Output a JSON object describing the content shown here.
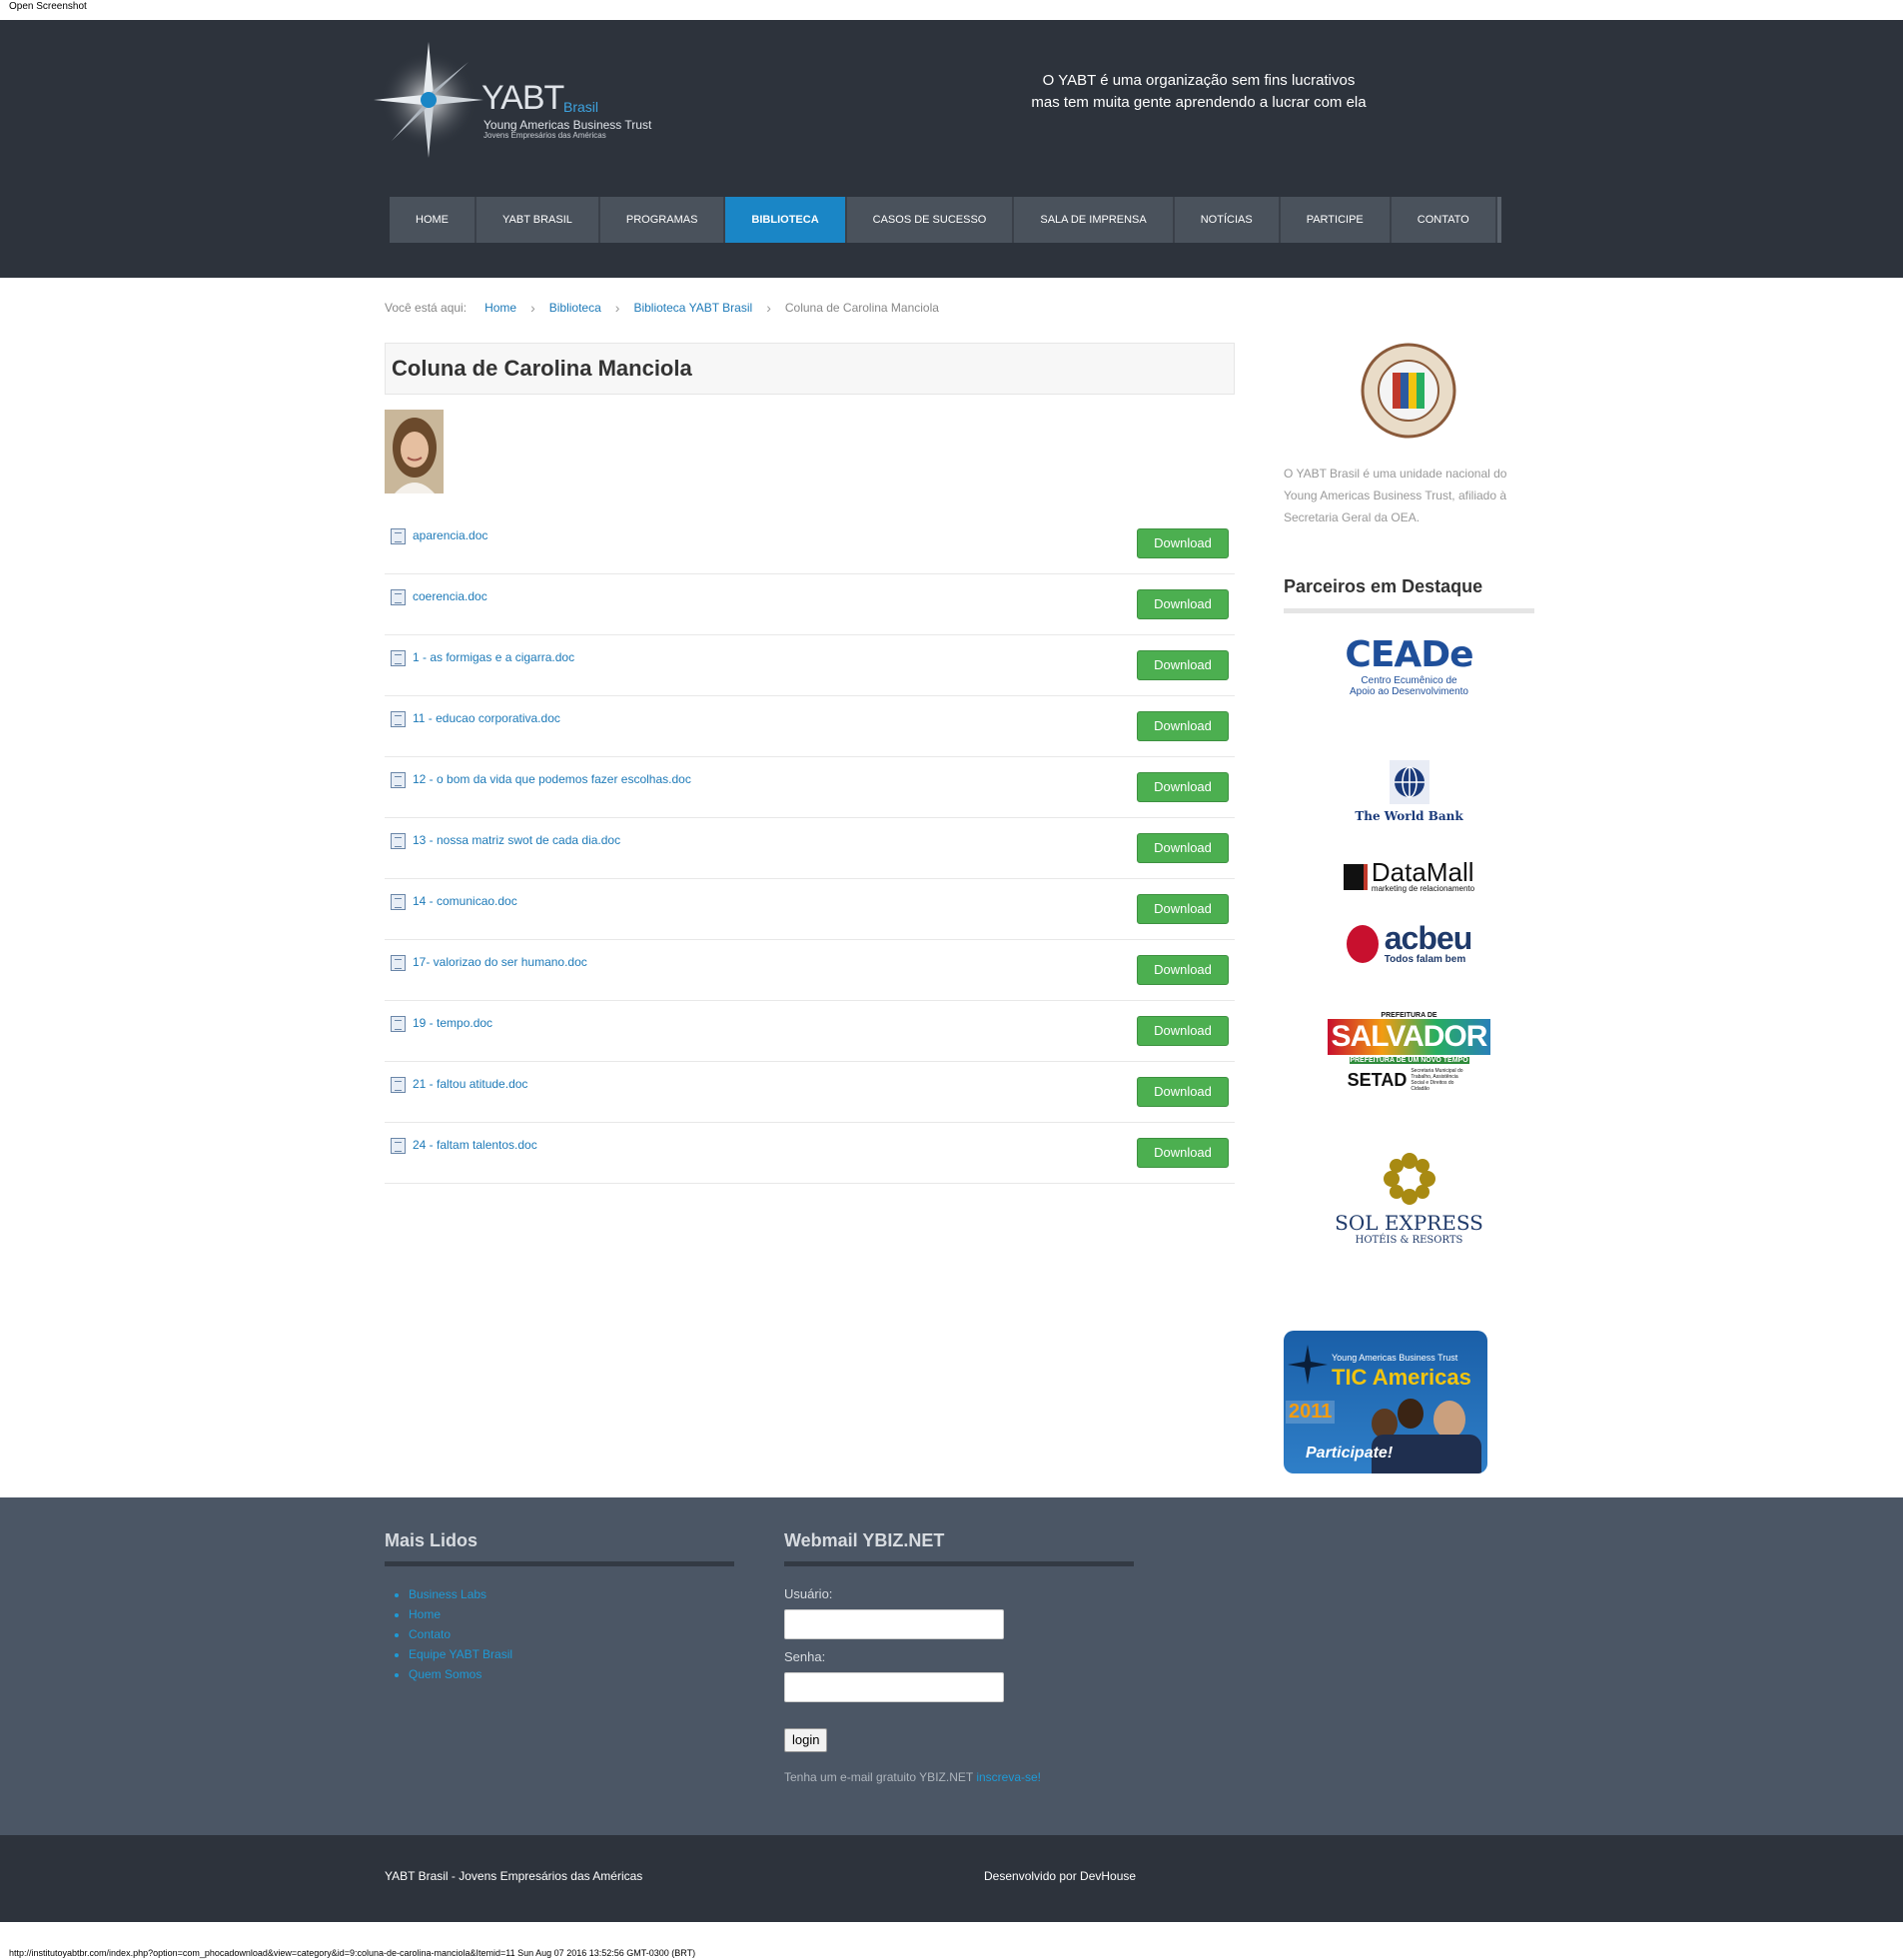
{
  "browser": {
    "top_label": "Open Screenshot",
    "status_url": "http://institutoyabtbr.com/index.php?option=com_phocadownload&view=category&id=9:coluna-de-carolina-manciola&Itemid=11 Sun Aug 07 2016 13:52:56 GMT-0300 (BRT)"
  },
  "header": {
    "logo": {
      "name": "YABT",
      "country": "Brasil",
      "subtitle": "Young Americas Business Trust",
      "subtitle2": "Jovens Empresários das Américas"
    },
    "tagline_line1": "O YABT é uma organização sem fins lucrativos",
    "tagline_line2": "mas tem muita gente aprendendo a lucrar com ela",
    "nav": [
      "HOME",
      "YABT BRASIL",
      "PROGRAMAS",
      "BIBLIOTECA",
      "CASOS DE SUCESSO",
      "SALA DE IMPRENSA",
      "NOTÍCIAS",
      "PARTICIPE",
      "CONTATO"
    ],
    "nav_active": "BIBLIOTECA"
  },
  "breadcrumb": {
    "prefix": "Você está aqui:",
    "items": [
      "Home",
      "Biblioteca",
      "Biblioteca YABT Brasil"
    ],
    "current": "Coluna de Carolina Manciola"
  },
  "page": {
    "title": "Coluna de Carolina Manciola",
    "download_label": "Download",
    "files": [
      "aparencia.doc",
      "coerencia.doc",
      "1 - as formigas e a cigarra.doc",
      "11 - educao corporativa.doc",
      "12 - o bom da vida que podemos fazer escolhas.doc",
      "13 - nossa matriz swot de cada dia.doc",
      "14 - comunicao.doc",
      "17- valorizao do ser humano.doc",
      "19 - tempo.doc",
      "21 - faltou atitude.doc",
      "24 - faltam talentos.doc"
    ]
  },
  "sidebar": {
    "oas_text": "O YABT Brasil é uma unidade nacional do Young Americas Business Trust, afiliado à Secretaria Geral da OEA.",
    "partners_title": "Parceiros em Destaque",
    "partners": {
      "ceade": "CEADe",
      "ceade_sub1": "Centro Ecumênico de",
      "ceade_sub2": "Apoio ao Desenvolvimento",
      "worldbank": "The World Bank",
      "datamall": "DataMall",
      "datamall_sub": "marketing de relacionamento",
      "acbeu": "acbeu",
      "acbeu_sub": "Todos falam bem",
      "salvador_top": "PREFEITURA DE",
      "salvador": "SALVADOR",
      "salvador_sub": "PREFEITURA DE UM NOVO TEMPO",
      "setad": "SETAD",
      "setad_sub": "Secretaria Municipal do Trabalho, Assistência Social e Direitos do Cidadão",
      "sol": "SOL EXPRESS",
      "sol_sub": "HOTÉIS & RESORTS"
    },
    "banner": {
      "top": "Young Americas Business Trust",
      "title": "TIC Americas",
      "year": "2011",
      "cta": "Participate!"
    }
  },
  "footer": {
    "mais_lidos_title": "Mais Lidos",
    "mais_lidos": [
      "Business Labs",
      "Home",
      "Contato",
      "Equipe YABT Brasil",
      "Quem Somos"
    ],
    "webmail_title": "Webmail YBIZ.NET",
    "user_label": "Usuário:",
    "pass_label": "Senha:",
    "login_label": "login",
    "signup_text": "Tenha um e-mail gratuito YBIZ.NET",
    "signup_link": "inscreva-se!"
  },
  "bottom": {
    "left": "YABT Brasil - Jovens Empresários das Américas",
    "right": "Desenvolvido por DevHouse"
  }
}
